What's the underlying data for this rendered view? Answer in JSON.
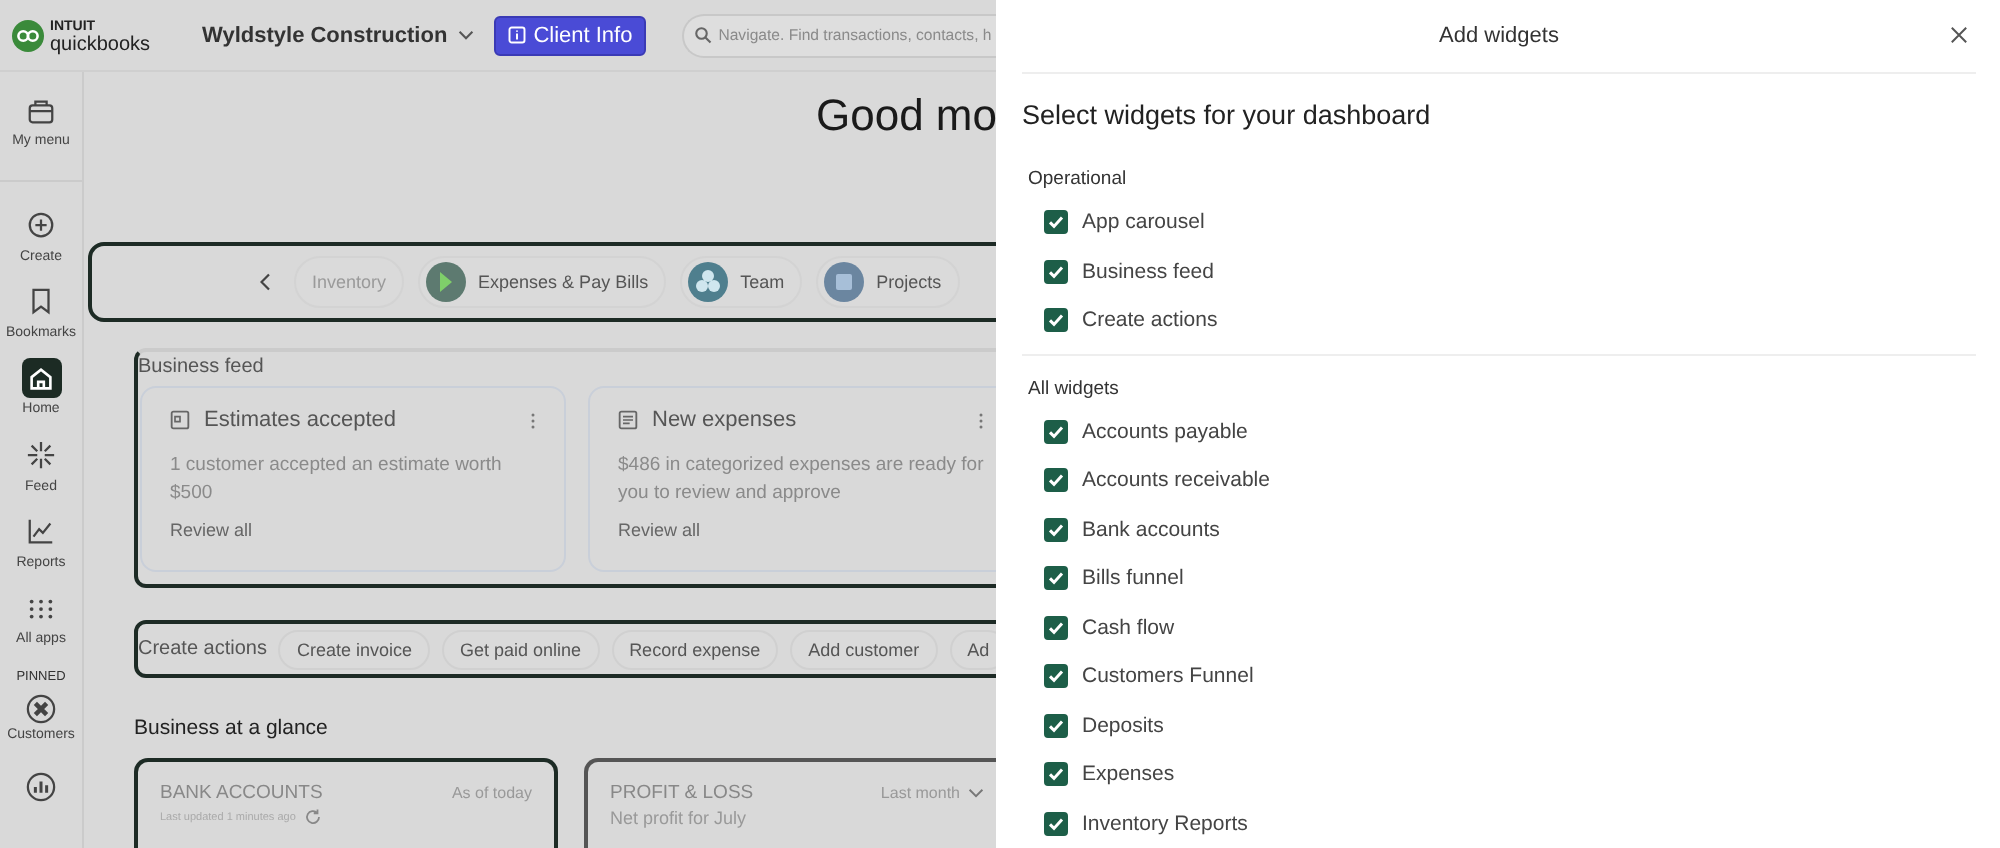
{
  "top_bar": {
    "logo": {
      "brand_top": "INTUIT",
      "brand": "quickbooks"
    },
    "company": "Wyldstyle Construction",
    "client_info_button": "Client Info",
    "search": {
      "placeholder": "Navigate. Find transactions, contacts, h"
    }
  },
  "sidebar": {
    "items": [
      {
        "label": "My menu",
        "kind": "menu",
        "selected": false
      },
      {
        "label": "Create",
        "kind": "create",
        "selected": false
      },
      {
        "label": "Bookmarks",
        "kind": "bookmarks",
        "selected": false
      },
      {
        "label": "Home",
        "kind": "home",
        "selected": true
      },
      {
        "label": "Feed",
        "kind": "feed",
        "selected": false
      },
      {
        "label": "Reports",
        "kind": "reports",
        "selected": false
      },
      {
        "label": "All apps",
        "kind": "apps",
        "selected": false
      }
    ],
    "pinned_label": "PINNED",
    "pinned": [
      {
        "label": "Customers",
        "kind": "customers"
      },
      {
        "kind": "chart"
      }
    ]
  },
  "greeting": "Good mo",
  "carousel": {
    "items": [
      {
        "label": "Inventory",
        "kind": "faded"
      },
      {
        "label": "Expenses & Pay Bills",
        "kind": "expenses"
      },
      {
        "label": "Team",
        "kind": "team"
      },
      {
        "label": "Projects",
        "kind": "projects"
      }
    ]
  },
  "business_feed": {
    "title": "Business feed",
    "cards": [
      {
        "title": "Estimates accepted",
        "kind": "estimate",
        "body": "1 customer accepted an estimate worth $500",
        "link": "Review all"
      },
      {
        "title": "New expenses",
        "kind": "expense",
        "body": "$486 in categorized expenses are ready for you to review and approve",
        "link": "Review all"
      }
    ]
  },
  "create_actions": {
    "title": "Create actions",
    "actions": [
      "Create invoice",
      "Get paid online",
      "Record expense",
      "Add customer",
      "Ad"
    ]
  },
  "glance": {
    "title": "Business at a glance",
    "cards": [
      {
        "title": "BANK ACCOUNTS",
        "period": "As of today",
        "subtitle": "Last updated 1 minutes ago",
        "kind": "bank"
      },
      {
        "title": "PROFIT & LOSS",
        "period": "Last month",
        "subtitle": "Net profit for July",
        "kind": "pnl"
      }
    ]
  },
  "panel": {
    "title": "Add widgets",
    "heading": "Select widgets for your dashboard",
    "groups": [
      {
        "title": "Operational",
        "items": [
          {
            "label": "App carousel",
            "checked": true
          },
          {
            "label": "Business feed",
            "checked": true
          },
          {
            "label": "Create actions",
            "checked": true
          }
        ]
      },
      {
        "title": "All widgets",
        "items": [
          {
            "label": "Accounts payable",
            "checked": true
          },
          {
            "label": "Accounts receivable",
            "checked": true
          },
          {
            "label": "Bank accounts",
            "checked": true
          },
          {
            "label": "Bills funnel",
            "checked": true
          },
          {
            "label": "Cash flow",
            "checked": true
          },
          {
            "label": "Customers Funnel",
            "checked": true
          },
          {
            "label": "Deposits",
            "checked": true
          },
          {
            "label": "Expenses",
            "checked": true
          },
          {
            "label": "Inventory Reports",
            "checked": true
          }
        ]
      }
    ]
  }
}
